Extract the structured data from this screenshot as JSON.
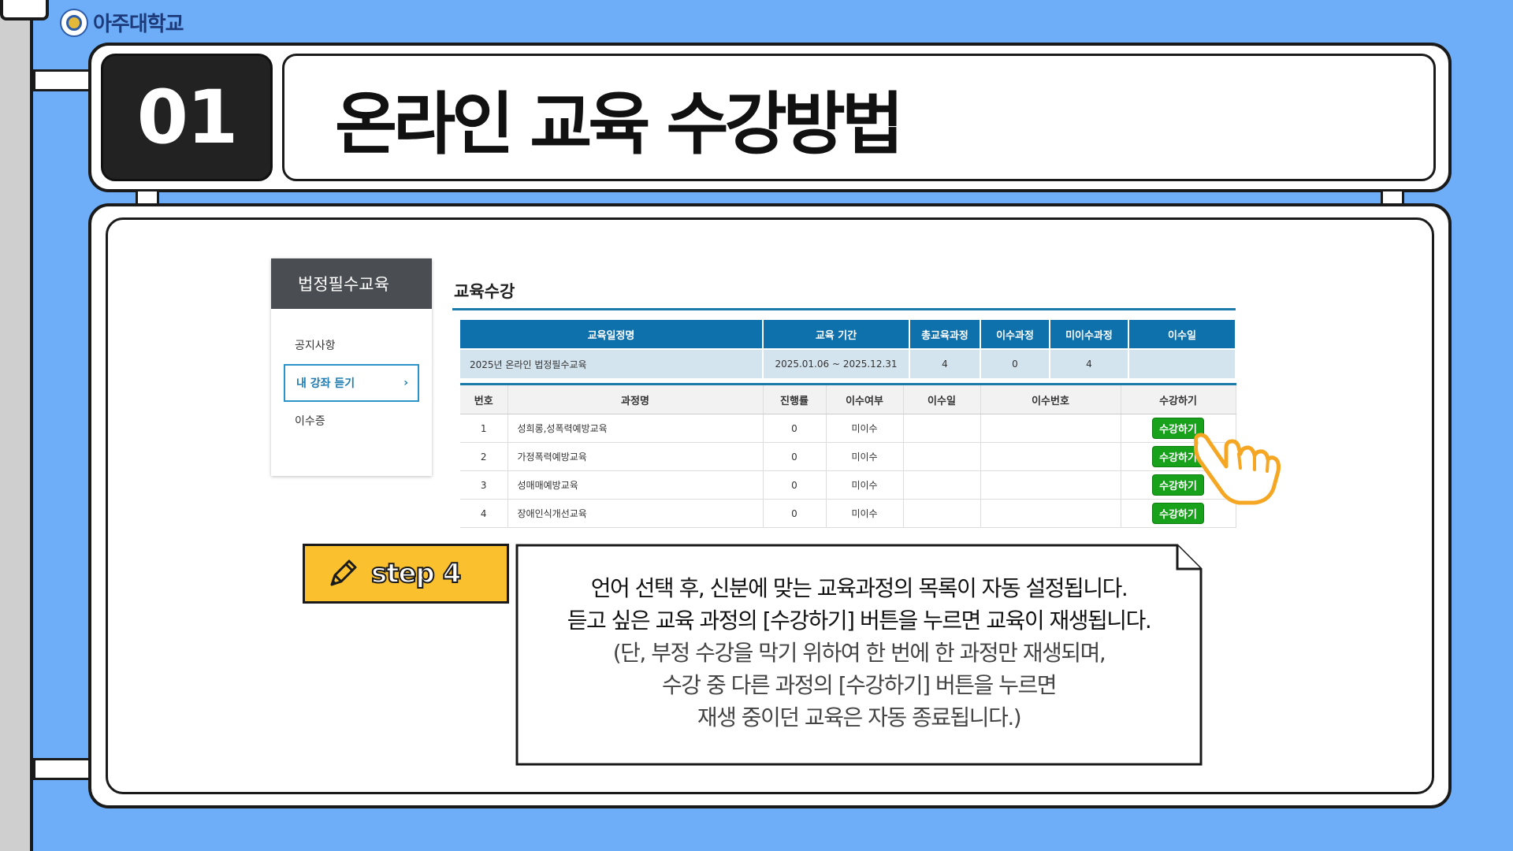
{
  "brand": {
    "logo_text": "아주대학교"
  },
  "header": {
    "number": "01",
    "title": "온라인 교육 수강방법"
  },
  "sidebar": {
    "heading": "법정필수교육",
    "items": [
      {
        "label": "공지사항"
      },
      {
        "label": "내 강좌 듣기",
        "active": true
      },
      {
        "label": "이수증"
      }
    ]
  },
  "section": {
    "title": "교육수강"
  },
  "summary_table": {
    "headers": [
      "교육일정명",
      "교육 기간",
      "총교육과정",
      "이수과정",
      "미이수과정",
      "이수일"
    ],
    "row": [
      "2025년 온라인 법정필수교육",
      "2025.01.06 ~ 2025.12.31",
      "4",
      "0",
      "4",
      ""
    ]
  },
  "course_table": {
    "headers": [
      "번호",
      "과정명",
      "진행률",
      "이수여부",
      "이수일",
      "이수번호",
      "수강하기"
    ],
    "rows": [
      {
        "no": "1",
        "name": "성희롱,성폭력예방교육",
        "progress": "0",
        "status": "미이수",
        "date": "",
        "cert": "",
        "action": "수강하기"
      },
      {
        "no": "2",
        "name": "가정폭력예방교육",
        "progress": "0",
        "status": "미이수",
        "date": "",
        "cert": "",
        "action": "수강하기"
      },
      {
        "no": "3",
        "name": "성매매예방교육",
        "progress": "0",
        "status": "미이수",
        "date": "",
        "cert": "",
        "action": "수강하기"
      },
      {
        "no": "4",
        "name": "장애인식개선교육",
        "progress": "0",
        "status": "미이수",
        "date": "",
        "cert": "",
        "action": "수강하기"
      }
    ]
  },
  "step": {
    "label": "step 4"
  },
  "description": {
    "lines": [
      "언어 선택 후, 신분에 맞는 교육과정의 목록이 자동 설정됩니다.",
      "듣고 싶은 교육 과정의 [수강하기] 버튼을 누르면 교육이 재생됩니다."
    ],
    "note_lines": [
      "(단, 부정 수강을 막기 위하여 한 번에 한 과정만 재생되며,",
      "수강 중 다른 과정의 [수강하기] 버튼을 누르면",
      "재생 중이던 교육은 자동 종료됩니다.)"
    ]
  },
  "colors": {
    "background": "#6eaef8",
    "table_header": "#0f71ac",
    "button": "#18a11b",
    "step_badge": "#fbc02d",
    "hand": "#f5a623"
  }
}
